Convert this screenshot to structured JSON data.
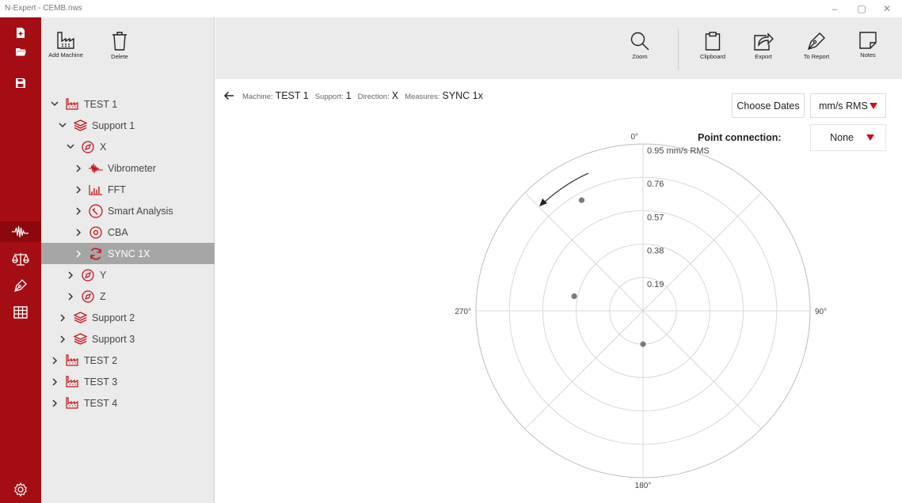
{
  "window": {
    "title": "N-Expert - CEMB.nws",
    "minimize": "–",
    "maximize": "▢",
    "close": "✕"
  },
  "rail": {
    "icons": [
      "new-file-icon",
      "open-folder-icon",
      "save-icon",
      "vibration-icon",
      "balance-icon",
      "pen-icon",
      "table-icon",
      "settings-icon"
    ]
  },
  "toolbar": {
    "add_machine": "Add Machine",
    "delete": "Delete",
    "zoom": "Zoom",
    "clipboard": "Clipboard",
    "export": "Export",
    "to_report": "To Report",
    "notes": "Notes"
  },
  "tree": {
    "items": [
      {
        "label": "TEST 1",
        "icon": "machine-icon",
        "expanded": true
      },
      {
        "label": "Support 1",
        "icon": "support-icon",
        "expanded": true
      },
      {
        "label": "X",
        "icon": "direction-icon",
        "expanded": true
      },
      {
        "label": "Vibrometer",
        "icon": "vibrometer-icon",
        "expanded": false
      },
      {
        "label": "FFT",
        "icon": "fft-icon",
        "expanded": false
      },
      {
        "label": "Smart Analysis",
        "icon": "smart-analysis-icon",
        "expanded": false
      },
      {
        "label": "CBA",
        "icon": "cba-icon",
        "expanded": false
      },
      {
        "label": "SYNC 1X",
        "icon": "sync-icon",
        "expanded": false,
        "selected": true
      },
      {
        "label": "Y",
        "icon": "direction-icon",
        "expanded": false
      },
      {
        "label": "Z",
        "icon": "direction-icon",
        "expanded": false
      },
      {
        "label": "Support 2",
        "icon": "support-icon",
        "expanded": false
      },
      {
        "label": "Support 3",
        "icon": "support-icon",
        "expanded": false
      },
      {
        "label": "TEST 2",
        "icon": "machine-icon",
        "expanded": false
      },
      {
        "label": "TEST 3",
        "icon": "machine-icon",
        "expanded": false
      },
      {
        "label": "TEST 4",
        "icon": "machine-icon",
        "expanded": false
      }
    ]
  },
  "breadcrumb": {
    "machine_key": "Machine:",
    "machine_val": "TEST 1",
    "support_key": "Support:",
    "support_val": "1",
    "direction_key": "Direction:",
    "direction_val": "X",
    "measures_key": "Measures:",
    "measures_val": "SYNC 1x"
  },
  "controls": {
    "choose_dates": "Choose Dates",
    "unit": "mm/s RMS",
    "point_connection_label": "Point connection:",
    "point_connection_value": "None"
  },
  "colors": {
    "accent": "#a50d14",
    "selected_row": "#a6a6a6",
    "point": "#7a7a7a"
  },
  "chart_data": {
    "type": "scatter",
    "coordinate_system": "polar",
    "angle_labels": [
      "0°",
      "90°",
      "180°",
      "270°"
    ],
    "radial_tick_labels": [
      "0.19",
      "0.38",
      "0.57",
      "0.76",
      "0.95 mm/s RMS"
    ],
    "radial_ticks": [
      0.19,
      0.38,
      0.57,
      0.76,
      0.95
    ],
    "rmax": 0.95,
    "rotation_arrow": "counter-clockwise",
    "points": [
      {
        "angle_deg": 331,
        "r": 0.72
      },
      {
        "angle_deg": 282,
        "r": 0.4
      },
      {
        "angle_deg": 180,
        "r": 0.19
      }
    ]
  }
}
